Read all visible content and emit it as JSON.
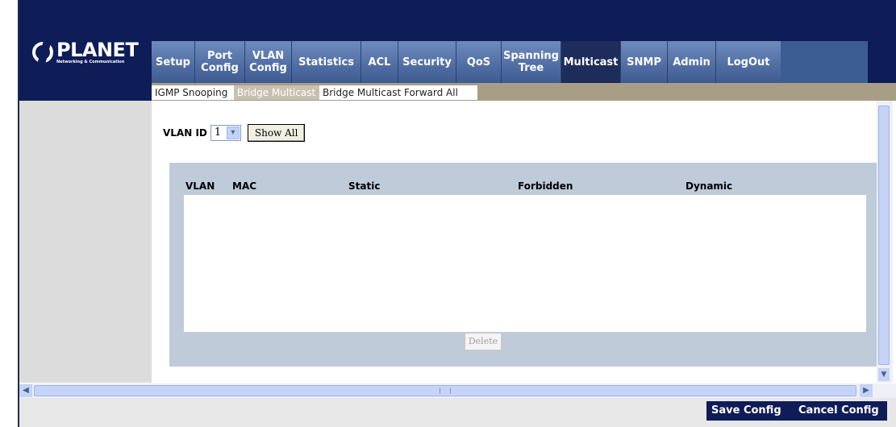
{
  "logo": {
    "word": "PLANET",
    "tagline": "Networking & Communication"
  },
  "tabs": [
    {
      "label": "Setup"
    },
    {
      "label": "Port\nConfig"
    },
    {
      "label": "VLAN\nConfig"
    },
    {
      "label": "Statistics"
    },
    {
      "label": "ACL"
    },
    {
      "label": "Security"
    },
    {
      "label": "QoS"
    },
    {
      "label": "Spanning\nTree"
    },
    {
      "label": "Multicast",
      "active": true
    },
    {
      "label": "SNMP"
    },
    {
      "label": "Admin"
    },
    {
      "label": "LogOut"
    }
  ],
  "subnav": {
    "items": [
      "IGMP Snooping",
      "Bridge Multicast",
      "Bridge Multicast Forward All"
    ],
    "active": "Bridge Multicast"
  },
  "form": {
    "vlan_label": "VLAN ID",
    "vlan_value": "1",
    "show_all_label": "Show All"
  },
  "table": {
    "columns": [
      "VLAN",
      "MAC",
      "Static",
      "Forbidden",
      "Dynamic"
    ],
    "rows": [],
    "delete_label": "Delete"
  },
  "footer": {
    "save_label": "Save Config",
    "cancel_label": "Cancel Config"
  },
  "colors": {
    "banner": "#0e1c58",
    "tab_gradient_top": "#6e8bbd",
    "tab_active": "#1e2c5c",
    "subnav": "#a79e85",
    "table_area": "#bfcbd9"
  }
}
